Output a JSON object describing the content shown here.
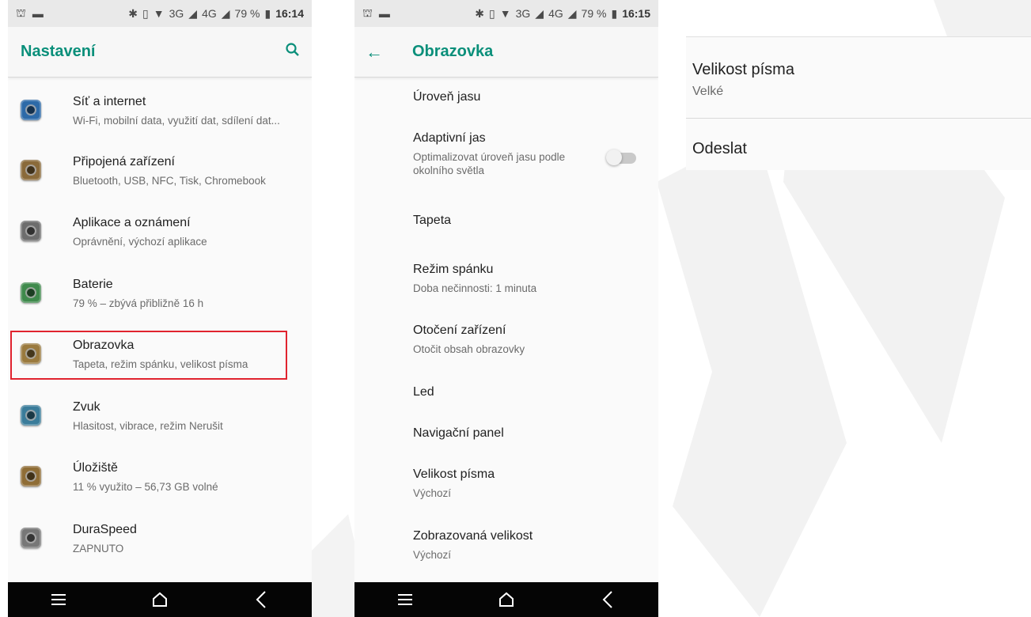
{
  "colors": {
    "accent": "#0a8f7a",
    "highlight": "#e0232e"
  },
  "screen1": {
    "status": {
      "time": "16:14",
      "battery": "79 %",
      "net1": "3G",
      "net2": "4G"
    },
    "title": "Nastavení",
    "search_icon": "search-icon",
    "items": [
      {
        "title": "Síť a internet",
        "subtitle": "Wi-Fi, mobilní data, využití dat, sdílení dat...",
        "icon": "network-icon",
        "color": "#2d6aa8"
      },
      {
        "title": "Připojená zařízení",
        "subtitle": "Bluetooth, USB, NFC, Tisk, Chromebook",
        "icon": "devices-icon",
        "color": "#8a6a3a"
      },
      {
        "title": "Aplikace a oznámení",
        "subtitle": "Oprávnění, výchozí aplikace",
        "icon": "apps-icon",
        "color": "#6d6d6d"
      },
      {
        "title": "Baterie",
        "subtitle": "79 % – zbývá přibližně 16 h",
        "icon": "battery-icon",
        "color": "#3f8a4c"
      },
      {
        "title": "Obrazovka",
        "subtitle": "Tapeta, režim spánku, velikost písma",
        "icon": "display-icon",
        "color": "#9a7a3e"
      },
      {
        "title": "Zvuk",
        "subtitle": "Hlasitost, vibrace, režim Nerušit",
        "icon": "sound-icon",
        "color": "#3a7c9a"
      },
      {
        "title": "Úložiště",
        "subtitle": "11 % využito – 56,73 GB volné",
        "icon": "storage-icon",
        "color": "#8f6d36"
      },
      {
        "title": "DuraSpeed",
        "subtitle": "ZAPNUTO",
        "icon": "duraspeed-icon",
        "color": "#777777"
      }
    ]
  },
  "screen2": {
    "status": {
      "time": "16:15",
      "battery": "79 %",
      "net1": "3G",
      "net2": "4G"
    },
    "title": "Obrazovka",
    "items": [
      {
        "title": "Úroveň jasu",
        "subtitle": ""
      },
      {
        "title": "Adaptivní jas",
        "subtitle": "Optimalizovat úroveň jasu podle okolního světla",
        "toggle": "off"
      },
      {
        "title": "Tapeta",
        "subtitle": ""
      },
      {
        "title": "Režim spánku",
        "subtitle": "Doba nečinnosti: 1 minuta"
      },
      {
        "title": "Otočení zařízení",
        "subtitle": "Otočit obsah obrazovky"
      },
      {
        "title": "Led",
        "subtitle": ""
      },
      {
        "title": "Navigační panel",
        "subtitle": ""
      },
      {
        "title": "Velikost písma",
        "subtitle": "Výchozí"
      },
      {
        "title": "Zobrazovaná velikost",
        "subtitle": "Výchozí"
      }
    ]
  },
  "screen3": {
    "font_title": "Velikost písma",
    "font_value": "Velké",
    "send": "Odeslat"
  },
  "navbar": {
    "icons": [
      "menu-icon",
      "home-icon",
      "back-icon"
    ]
  }
}
